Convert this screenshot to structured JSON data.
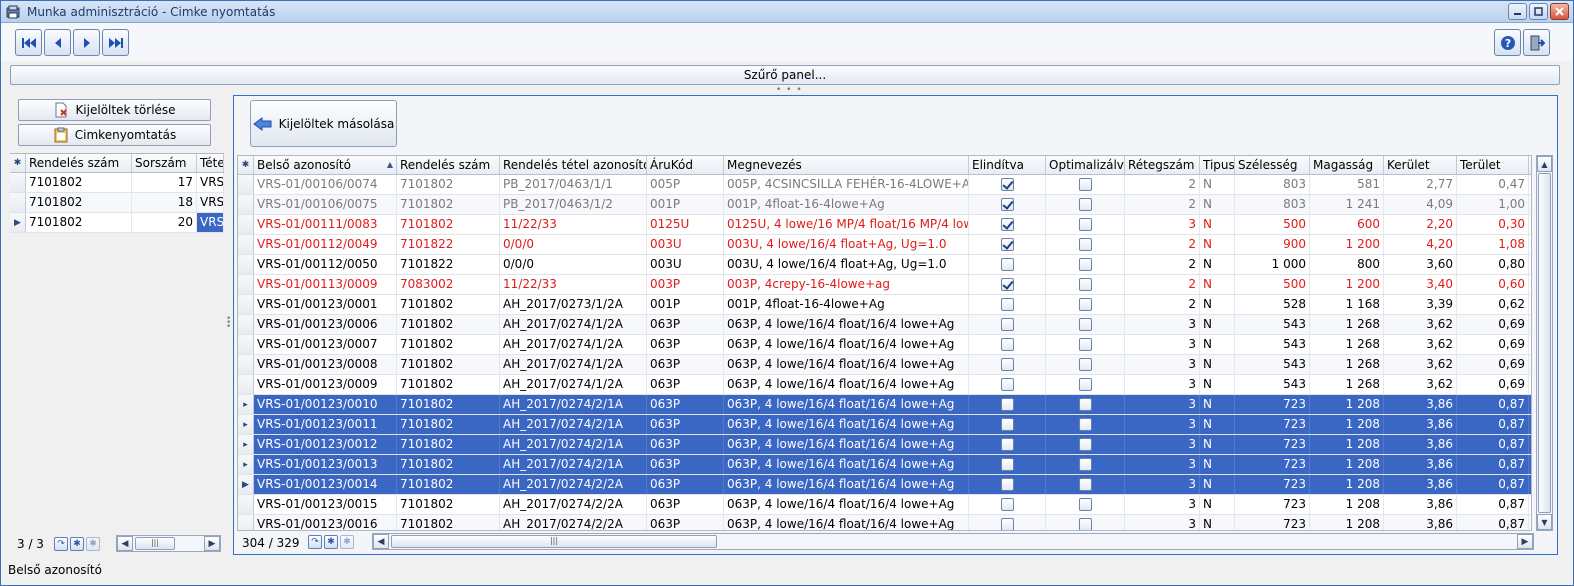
{
  "window": {
    "title": "Munka adminisztráció - Cimke nyomtatás"
  },
  "toolbar": {
    "nav_buttons": [
      "first-icon",
      "prev-icon",
      "next-icon",
      "last-icon"
    ],
    "right_buttons": [
      "help-icon",
      "exit-icon"
    ]
  },
  "filter_panel": {
    "label": "Szűrő panel..."
  },
  "left": {
    "delete_selected": "Kijelöltek törlése",
    "label_print": "Cimkenyomtatás",
    "columns": [
      "Rendelés szám",
      "Sorszám",
      "Tétel"
    ],
    "rows": [
      {
        "order": "7101802",
        "seq": "17",
        "item": "VRS"
      },
      {
        "order": "7101802",
        "seq": "18",
        "item": "VRS"
      },
      {
        "order": "7101802",
        "seq": "20",
        "item": "VRS"
      }
    ],
    "counter": "3 / 3"
  },
  "right": {
    "copy_selected": "Kijelöltek másolása",
    "columns": [
      "Belső azonosító",
      "Rendelés szám",
      "Rendelés tétel azonosító",
      "ÁruKód",
      "Megnevezés",
      "Elindítva",
      "Optimalizálva",
      "Rétegszám",
      "Tipus",
      "Szélesség",
      "Magasság",
      "Kerület",
      "Terület"
    ],
    "rows": [
      {
        "id": "VRS-01/00106/0074",
        "order": "7101802",
        "item": "PB_2017/0463/1/1",
        "code": "005P",
        "name": "005P, 4CSINCSILLA FEHÉR-16-4LOWE+AG",
        "started": true,
        "opt": false,
        "layers": "2",
        "type": "N",
        "width": "803",
        "height": "581",
        "perim": "2,77",
        "area": "0,47",
        "style": "grey"
      },
      {
        "id": "VRS-01/00106/0075",
        "order": "7101802",
        "item": "PB_2017/0463/1/2",
        "code": "001P",
        "name": "001P, 4float-16-4lowe+Ag",
        "started": true,
        "opt": false,
        "layers": "2",
        "type": "N",
        "width": "803",
        "height": "1 241",
        "perim": "4,09",
        "area": "1,00",
        "style": "grey"
      },
      {
        "id": "VRS-01/00111/0083",
        "order": "7101802",
        "item": "11/22/33",
        "code": "0125U",
        "name": "0125U, 4 lowe/16 MP/4 float/16 MP/4 lowe",
        "started": true,
        "opt": false,
        "layers": "3",
        "type": "N",
        "width": "500",
        "height": "600",
        "perim": "2,20",
        "area": "0,30",
        "style": "red"
      },
      {
        "id": "VRS-01/00112/0049",
        "order": "7101822",
        "item": "0/0/0",
        "code": "003U",
        "name": "003U, 4 lowe/16/4 float+Ag, Ug=1.0",
        "started": true,
        "opt": false,
        "layers": "2",
        "type": "N",
        "width": "900",
        "height": "1 200",
        "perim": "4,20",
        "area": "1,08",
        "style": "red"
      },
      {
        "id": "VRS-01/00112/0050",
        "order": "7101822",
        "item": "0/0/0",
        "code": "003U",
        "name": "003U, 4 lowe/16/4 float+Ag, Ug=1.0",
        "started": false,
        "opt": false,
        "layers": "2",
        "type": "N",
        "width": "1 000",
        "height": "800",
        "perim": "3,60",
        "area": "0,80",
        "style": "normal"
      },
      {
        "id": "VRS-01/00113/0009",
        "order": "7083002",
        "item": "11/22/33",
        "code": "003P",
        "name": "003P, 4crepy-16-4lowe+ag",
        "started": true,
        "opt": false,
        "layers": "2",
        "type": "N",
        "width": "500",
        "height": "1 200",
        "perim": "3,40",
        "area": "0,60",
        "style": "red"
      },
      {
        "id": "VRS-01/00123/0001",
        "order": "7101802",
        "item": "AH_2017/0273/1/2A",
        "code": "001P",
        "name": "001P, 4float-16-4lowe+Ag",
        "started": false,
        "opt": false,
        "layers": "2",
        "type": "N",
        "width": "528",
        "height": "1 168",
        "perim": "3,39",
        "area": "0,62",
        "style": "normal"
      },
      {
        "id": "VRS-01/00123/0006",
        "order": "7101802",
        "item": "AH_2017/0274/1/2A",
        "code": "063P",
        "name": "063P, 4 lowe/16/4 float/16/4 lowe+Ag",
        "started": false,
        "opt": false,
        "layers": "3",
        "type": "N",
        "width": "543",
        "height": "1 268",
        "perim": "3,62",
        "area": "0,69",
        "style": "normal"
      },
      {
        "id": "VRS-01/00123/0007",
        "order": "7101802",
        "item": "AH_2017/0274/1/2A",
        "code": "063P",
        "name": "063P, 4 lowe/16/4 float/16/4 lowe+Ag",
        "started": false,
        "opt": false,
        "layers": "3",
        "type": "N",
        "width": "543",
        "height": "1 268",
        "perim": "3,62",
        "area": "0,69",
        "style": "normal"
      },
      {
        "id": "VRS-01/00123/0008",
        "order": "7101802",
        "item": "AH_2017/0274/1/2A",
        "code": "063P",
        "name": "063P, 4 lowe/16/4 float/16/4 lowe+Ag",
        "started": false,
        "opt": false,
        "layers": "3",
        "type": "N",
        "width": "543",
        "height": "1 268",
        "perim": "3,62",
        "area": "0,69",
        "style": "normal"
      },
      {
        "id": "VRS-01/00123/0009",
        "order": "7101802",
        "item": "AH_2017/0274/1/2A",
        "code": "063P",
        "name": "063P, 4 lowe/16/4 float/16/4 lowe+Ag",
        "started": false,
        "opt": false,
        "layers": "3",
        "type": "N",
        "width": "543",
        "height": "1 268",
        "perim": "3,62",
        "area": "0,69",
        "style": "normal"
      },
      {
        "id": "VRS-01/00123/0010",
        "order": "7101802",
        "item": "AH_2017/0274/2/1A",
        "code": "063P",
        "name": "063P, 4 lowe/16/4 float/16/4 lowe+Ag",
        "started": false,
        "opt": false,
        "layers": "3",
        "type": "N",
        "width": "723",
        "height": "1 208",
        "perim": "3,86",
        "area": "0,87",
        "style": "sel"
      },
      {
        "id": "VRS-01/00123/0011",
        "order": "7101802",
        "item": "AH_2017/0274/2/1A",
        "code": "063P",
        "name": "063P, 4 lowe/16/4 float/16/4 lowe+Ag",
        "started": false,
        "opt": false,
        "layers": "3",
        "type": "N",
        "width": "723",
        "height": "1 208",
        "perim": "3,86",
        "area": "0,87",
        "style": "sel"
      },
      {
        "id": "VRS-01/00123/0012",
        "order": "7101802",
        "item": "AH_2017/0274/2/1A",
        "code": "063P",
        "name": "063P, 4 lowe/16/4 float/16/4 lowe+Ag",
        "started": false,
        "opt": false,
        "layers": "3",
        "type": "N",
        "width": "723",
        "height": "1 208",
        "perim": "3,86",
        "area": "0,87",
        "style": "sel"
      },
      {
        "id": "VRS-01/00123/0013",
        "order": "7101802",
        "item": "AH_2017/0274/2/1A",
        "code": "063P",
        "name": "063P, 4 lowe/16/4 float/16/4 lowe+Ag",
        "started": false,
        "opt": false,
        "layers": "3",
        "type": "N",
        "width": "723",
        "height": "1 208",
        "perim": "3,86",
        "area": "0,87",
        "style": "sel"
      },
      {
        "id": "VRS-01/00123/0014",
        "order": "7101802",
        "item": "AH_2017/0274/2/2A",
        "code": "063P",
        "name": "063P, 4 lowe/16/4 float/16/4 lowe+Ag",
        "started": false,
        "opt": false,
        "layers": "3",
        "type": "N",
        "width": "723",
        "height": "1 208",
        "perim": "3,86",
        "area": "0,87",
        "style": "sel-cur"
      },
      {
        "id": "VRS-01/00123/0015",
        "order": "7101802",
        "item": "AH_2017/0274/2/2A",
        "code": "063P",
        "name": "063P, 4 lowe/16/4 float/16/4 lowe+Ag",
        "started": false,
        "opt": false,
        "layers": "3",
        "type": "N",
        "width": "723",
        "height": "1 208",
        "perim": "3,86",
        "area": "0,87",
        "style": "normal"
      },
      {
        "id": "VRS-01/00123/0016",
        "order": "7101802",
        "item": "AH_2017/0274/2/2A",
        "code": "063P",
        "name": "063P, 4 lowe/16/4 float/16/4 lowe+Ag",
        "started": false,
        "opt": false,
        "layers": "3",
        "type": "N",
        "width": "723",
        "height": "1 208",
        "perim": "3,86",
        "area": "0,87",
        "style": "normal"
      }
    ],
    "counter": "304 / 329"
  },
  "statusbar": {
    "text": "Belső azonosító"
  },
  "colors": {
    "selection": "#3a66c4",
    "highlight": "#e01b1b",
    "panel_border": "#2f6fd0"
  }
}
